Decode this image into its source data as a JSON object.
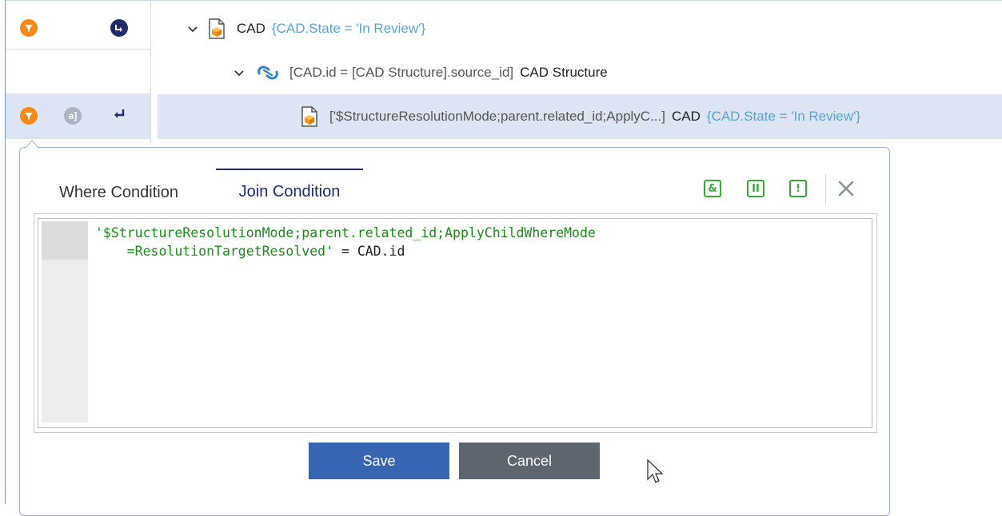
{
  "tree": {
    "rows": [
      {
        "label": "CAD",
        "condition": "{CAD.State = 'In Review'}"
      },
      {
        "join": "[CAD.id = [CAD Structure].source_id]",
        "label": "CAD Structure"
      },
      {
        "join": "['$StructureResolutionMode;parent.related_id;ApplyC...]",
        "label": "CAD",
        "condition": "{CAD.State = 'In Review'}"
      }
    ],
    "alias_badge": "a]"
  },
  "dialog": {
    "tabs": {
      "where": "Where Condition",
      "join": "Join Condition"
    },
    "toolbar": {
      "and": "&",
      "or": "II",
      "not": "!"
    },
    "code": {
      "line1": "'$StructureResolutionMode;parent.related_id;ApplyChildWhereMode",
      "line2_str": "    =ResolutionTargetResolved'",
      "line2_rest": " = CAD.id"
    },
    "buttons": {
      "save": "Save",
      "cancel": "Cancel"
    }
  },
  "colors": {
    "accent_orange": "#f08a1c",
    "navy": "#1f2a6b",
    "green": "#3aa838",
    "save_blue": "#3765b0",
    "cancel_gray": "#5d656e",
    "selection": "#dde5f3",
    "condition_blue": "#5aa3d6"
  }
}
